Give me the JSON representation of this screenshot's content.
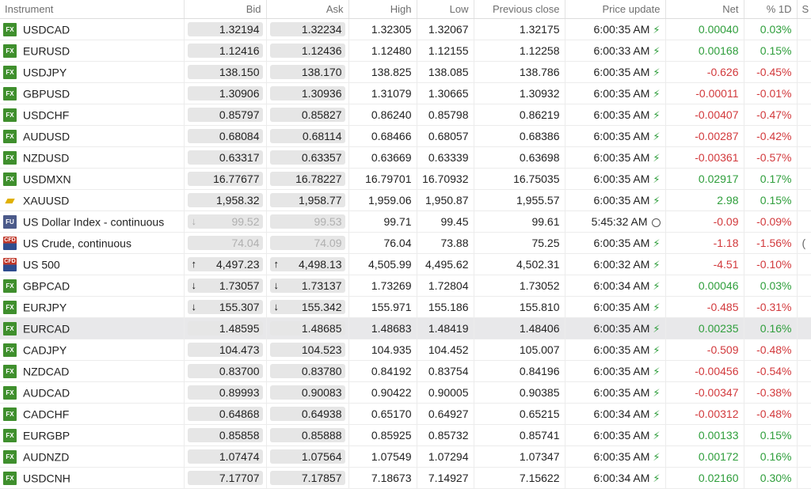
{
  "columns": {
    "instrument": "Instrument",
    "bid": "Bid",
    "ask": "Ask",
    "high": "High",
    "low": "Low",
    "prev_close": "Previous close",
    "price_update": "Price update",
    "net": "Net",
    "pct": "% 1D",
    "s": "S"
  },
  "rows": [
    {
      "badge": "fx",
      "badge_text": "FX",
      "name": "USDCAD",
      "bid": "1.32194",
      "ask": "1.32234",
      "high": "1.32305",
      "low": "1.32067",
      "prev": "1.32175",
      "time": "6:00:35 AM",
      "upd": "bolt",
      "net": "0.00040",
      "pct": "0.03%",
      "dir": "pos"
    },
    {
      "badge": "fx",
      "badge_text": "FX",
      "name": "EURUSD",
      "bid": "1.12416",
      "ask": "1.12436",
      "high": "1.12480",
      "low": "1.12155",
      "prev": "1.12258",
      "time": "6:00:33 AM",
      "upd": "bolt",
      "net": "0.00168",
      "pct": "0.15%",
      "dir": "pos"
    },
    {
      "badge": "fx",
      "badge_text": "FX",
      "name": "USDJPY",
      "bid": "138.150",
      "ask": "138.170",
      "high": "138.825",
      "low": "138.085",
      "prev": "138.786",
      "time": "6:00:35 AM",
      "upd": "bolt",
      "net": "-0.626",
      "pct": "-0.45%",
      "dir": "neg"
    },
    {
      "badge": "fx",
      "badge_text": "FX",
      "name": "GBPUSD",
      "bid": "1.30906",
      "ask": "1.30936",
      "high": "1.31079",
      "low": "1.30665",
      "prev": "1.30932",
      "time": "6:00:35 AM",
      "upd": "bolt",
      "net": "-0.00011",
      "pct": "-0.01%",
      "dir": "neg"
    },
    {
      "badge": "fx",
      "badge_text": "FX",
      "name": "USDCHF",
      "bid": "0.85797",
      "ask": "0.85827",
      "high": "0.86240",
      "low": "0.85798",
      "prev": "0.86219",
      "time": "6:00:35 AM",
      "upd": "bolt",
      "net": "-0.00407",
      "pct": "-0.47%",
      "dir": "neg"
    },
    {
      "badge": "fx",
      "badge_text": "FX",
      "name": "AUDUSD",
      "bid": "0.68084",
      "ask": "0.68114",
      "high": "0.68466",
      "low": "0.68057",
      "prev": "0.68386",
      "time": "6:00:35 AM",
      "upd": "bolt",
      "net": "-0.00287",
      "pct": "-0.42%",
      "dir": "neg"
    },
    {
      "badge": "fx",
      "badge_text": "FX",
      "name": "NZDUSD",
      "bid": "0.63317",
      "ask": "0.63357",
      "high": "0.63669",
      "low": "0.63339",
      "prev": "0.63698",
      "time": "6:00:35 AM",
      "upd": "bolt",
      "net": "-0.00361",
      "pct": "-0.57%",
      "dir": "neg"
    },
    {
      "badge": "fx",
      "badge_text": "FX",
      "name": "USDMXN",
      "bid": "16.77677",
      "ask": "16.78227",
      "high": "16.79701",
      "low": "16.70932",
      "prev": "16.75035",
      "time": "6:00:35 AM",
      "upd": "bolt",
      "net": "0.02917",
      "pct": "0.17%",
      "dir": "pos"
    },
    {
      "badge": "gold",
      "badge_text": "▰",
      "name": "XAUUSD",
      "bid": "1,958.32",
      "ask": "1,958.77",
      "high": "1,959.06",
      "low": "1,950.87",
      "prev": "1,955.57",
      "time": "6:00:35 AM",
      "upd": "bolt",
      "net": "2.98",
      "pct": "0.15%",
      "dir": "pos"
    },
    {
      "badge": "fu",
      "badge_text": "FU",
      "name": "US Dollar Index - continuous",
      "bid": "99.52",
      "ask": "99.53",
      "high": "99.71",
      "low": "99.45",
      "prev": "99.61",
      "time": "5:45:32 AM",
      "upd": "clock",
      "net": "-0.09",
      "pct": "-0.09%",
      "dir": "neg",
      "stale": true,
      "bid_arrow": "grey"
    },
    {
      "badge": "cfd",
      "badge_text": "CFD",
      "name": "US Crude, continuous",
      "bid": "74.04",
      "ask": "74.09",
      "high": "76.04",
      "low": "73.88",
      "prev": "75.25",
      "time": "6:00:35 AM",
      "upd": "bolt",
      "net": "-1.18",
      "pct": "-1.56%",
      "dir": "neg",
      "stale": true,
      "s": "("
    },
    {
      "badge": "cfd",
      "badge_text": "CFD",
      "name": "US 500",
      "bid": "4,497.23",
      "ask": "4,498.13",
      "high": "4,505.99",
      "low": "4,495.62",
      "prev": "4,502.31",
      "time": "6:00:32 AM",
      "upd": "bolt",
      "net": "-4.51",
      "pct": "-0.10%",
      "dir": "neg",
      "bid_arrow": "up",
      "ask_arrow": "up"
    },
    {
      "badge": "fx",
      "badge_text": "FX",
      "name": "GBPCAD",
      "bid": "1.73057",
      "ask": "1.73137",
      "high": "1.73269",
      "low": "1.72804",
      "prev": "1.73052",
      "time": "6:00:34 AM",
      "upd": "bolt",
      "net": "0.00046",
      "pct": "0.03%",
      "dir": "pos",
      "bid_arrow": "dn",
      "ask_arrow": "dn"
    },
    {
      "badge": "fx",
      "badge_text": "FX",
      "name": "EURJPY",
      "bid": "155.307",
      "ask": "155.342",
      "high": "155.971",
      "low": "155.186",
      "prev": "155.810",
      "time": "6:00:35 AM",
      "upd": "bolt",
      "net": "-0.485",
      "pct": "-0.31%",
      "dir": "neg",
      "bid_arrow": "dn",
      "ask_arrow": "dn"
    },
    {
      "badge": "fx",
      "badge_text": "FX",
      "name": "EURCAD",
      "bid": "1.48595",
      "ask": "1.48685",
      "high": "1.48683",
      "low": "1.48419",
      "prev": "1.48406",
      "time": "6:00:35 AM",
      "upd": "bolt",
      "net": "0.00235",
      "pct": "0.16%",
      "dir": "pos",
      "selected": true
    },
    {
      "badge": "fx",
      "badge_text": "FX",
      "name": "CADJPY",
      "bid": "104.473",
      "ask": "104.523",
      "high": "104.935",
      "low": "104.452",
      "prev": "105.007",
      "time": "6:00:35 AM",
      "upd": "bolt",
      "net": "-0.509",
      "pct": "-0.48%",
      "dir": "neg"
    },
    {
      "badge": "fx",
      "badge_text": "FX",
      "name": "NZDCAD",
      "bid": "0.83700",
      "ask": "0.83780",
      "high": "0.84192",
      "low": "0.83754",
      "prev": "0.84196",
      "time": "6:00:35 AM",
      "upd": "bolt",
      "net": "-0.00456",
      "pct": "-0.54%",
      "dir": "neg"
    },
    {
      "badge": "fx",
      "badge_text": "FX",
      "name": "AUDCAD",
      "bid": "0.89993",
      "ask": "0.90083",
      "high": "0.90422",
      "low": "0.90005",
      "prev": "0.90385",
      "time": "6:00:35 AM",
      "upd": "bolt",
      "net": "-0.00347",
      "pct": "-0.38%",
      "dir": "neg"
    },
    {
      "badge": "fx",
      "badge_text": "FX",
      "name": "CADCHF",
      "bid": "0.64868",
      "ask": "0.64938",
      "high": "0.65170",
      "low": "0.64927",
      "prev": "0.65215",
      "time": "6:00:34 AM",
      "upd": "bolt",
      "net": "-0.00312",
      "pct": "-0.48%",
      "dir": "neg"
    },
    {
      "badge": "fx",
      "badge_text": "FX",
      "name": "EURGBP",
      "bid": "0.85858",
      "ask": "0.85888",
      "high": "0.85925",
      "low": "0.85732",
      "prev": "0.85741",
      "time": "6:00:35 AM",
      "upd": "bolt",
      "net": "0.00133",
      "pct": "0.15%",
      "dir": "pos"
    },
    {
      "badge": "fx",
      "badge_text": "FX",
      "name": "AUDNZD",
      "bid": "1.07474",
      "ask": "1.07564",
      "high": "1.07549",
      "low": "1.07294",
      "prev": "1.07347",
      "time": "6:00:35 AM",
      "upd": "bolt",
      "net": "0.00172",
      "pct": "0.16%",
      "dir": "pos"
    },
    {
      "badge": "fx",
      "badge_text": "FX",
      "name": "USDCNH",
      "bid": "7.17707",
      "ask": "7.17857",
      "high": "7.18673",
      "low": "7.14927",
      "prev": "7.15622",
      "time": "6:00:34 AM",
      "upd": "bolt",
      "net": "0.02160",
      "pct": "0.30%",
      "dir": "pos"
    }
  ],
  "colors": {
    "positive": "#2e9e3b",
    "negative": "#d2393c",
    "fx_badge": "#3f8f2d",
    "selected_row": "#e8e8ea"
  }
}
